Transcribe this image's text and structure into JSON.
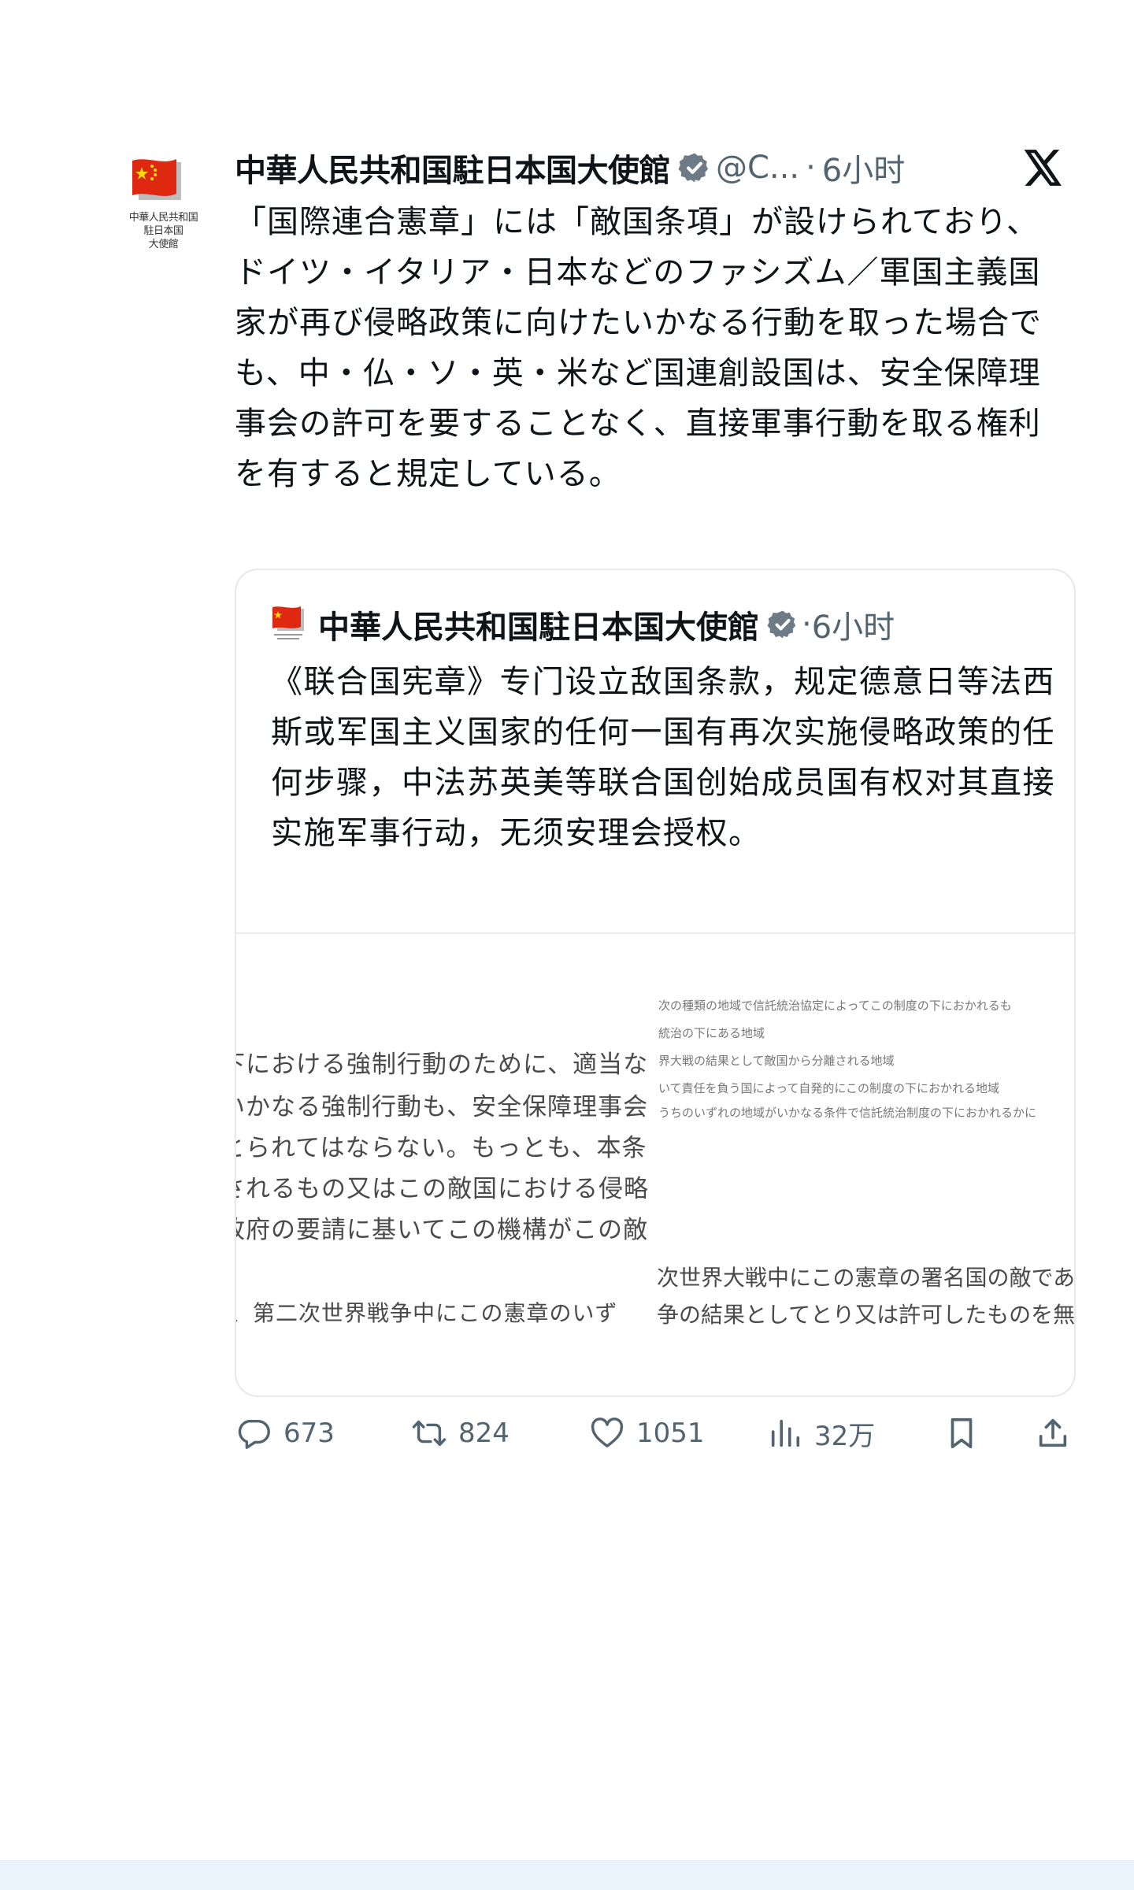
{
  "account": {
    "avatar_caption": "中華人民共和国\n駐日本国\n大使館",
    "name": "中華人民共和国駐日本国大使館",
    "handle": "@C...",
    "separator": "·",
    "time": "6小时"
  },
  "tweet": {
    "text": "「国際連合憲章」には「敵国条項」が設けられており、ドイツ・イタリア・日本などのファシズム／軍国主義国家が再び侵略政策に向けたいかなる行動を取った場合でも、中・仏・ソ・英・米など国連創設国は、安全保障理事会の許可を要することなく、直接軍事行動を取る権利を有すると規定している。"
  },
  "quote": {
    "name": "中華人民共和国駐日本国大使館",
    "separator": "·",
    "time": "6小时",
    "text": "《联合国宪章》专门设立敌国条款，规定德意日等法西斯或军国主义国家的任何一国有再次实施侵略政策的任何步骤，中法苏英美等联合国创始成员国有权对其直接实施军事行动，无须安理会授权。",
    "media_left_lines": [
      "下における強制行動のために、適当な",
      "いかなる強制行動も、安全保障理事会",
      "とられてはならない。もっとも、本条",
      "されるもの又はこの敵国における侵略",
      "政府の要請に基いてこの機構がこの敵",
      "、第二次世界戦争中にこの憲章のいず"
    ],
    "media_right_small": [
      "次の種類の地域で信託統治協定によってこの制度の下におかれるも",
      "統治の下にある地域",
      "界大戦の結果として敵国から分離される地域",
      "いて責任を負う国によって自発的にこの制度の下におかれる地域",
      "うちのいずれの地域がいかなる条件で信託統治制度の下におかれるかに"
    ],
    "media_right_big": [
      "次世界大戦中にこの憲章の署名国の敵であ",
      "争の結果としてとり又は許可したものを無"
    ]
  },
  "actions": {
    "replies": "673",
    "reposts": "824",
    "likes": "1051",
    "views": "32万"
  },
  "colors": {
    "verified": "#6e7a85",
    "secondary_text": "#536471",
    "flag_red": "#de2910",
    "flag_yellow": "#ffde00"
  }
}
